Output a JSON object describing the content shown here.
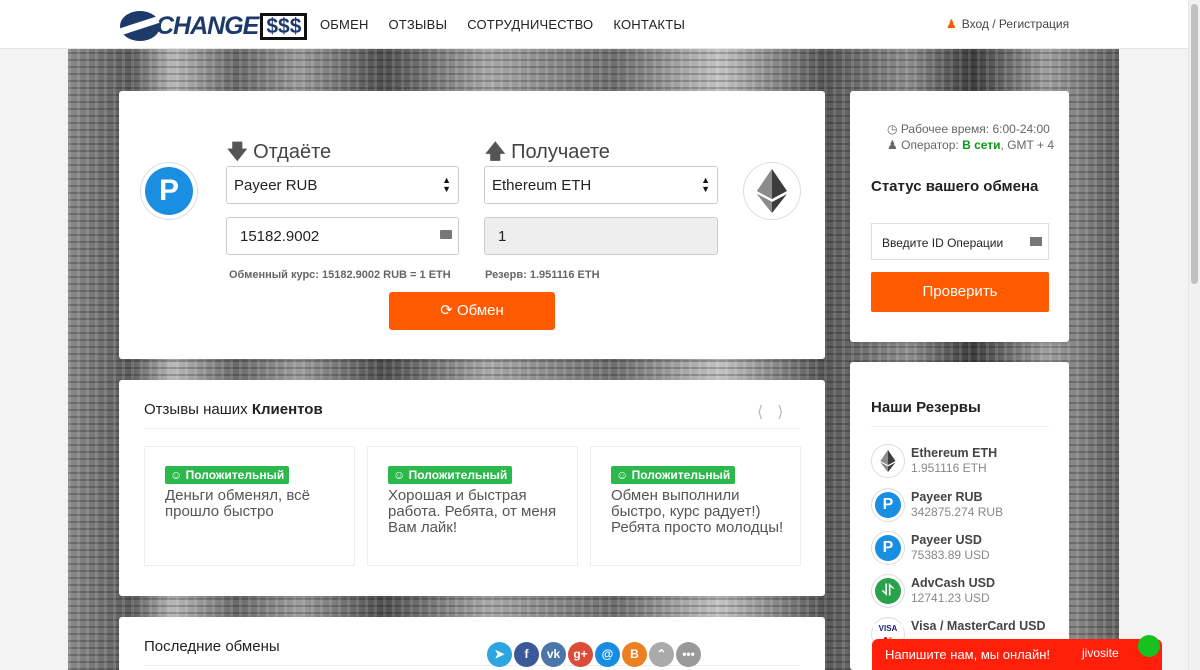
{
  "header": {
    "logo_text": "CHANGE",
    "logo_dollars": "$$$",
    "nav": [
      "ОБМЕН",
      "ОТЗЫВЫ",
      "СОТРУДНИЧЕСТВО",
      "КОНТАКТЫ"
    ],
    "login": "Вход / Регистрация"
  },
  "exchange": {
    "give_label": "Отдаёте",
    "get_label": "Получаете",
    "give_currency": "Payeer RUB",
    "get_currency": "Ethereum ETH",
    "give_amount": "15182.9002",
    "get_amount": "1",
    "rate": "Обменный курс: 15182.9002 RUB = 1 ETH",
    "reserve": "Резерв: 1.951116 ETH",
    "button": "Обмен",
    "give_icon_letter": "P"
  },
  "status": {
    "work_time": "Рабочее время: 6:00-24:00",
    "operator_label": "Оператор:",
    "operator_status": "В сети",
    "timezone": ", GMT + 4",
    "title": "Статус вашего обмена",
    "input_placeholder": "Введите ID Операции",
    "button": "Проверить"
  },
  "reviews": {
    "title_prefix": "Отзывы наших",
    "title_bold": "Клиентов",
    "items": [
      {
        "badge": "Положительный",
        "text": "Деньги обменял, всё прошло быстро"
      },
      {
        "badge": "Положительный",
        "text": "Хорошая и быстрая работа. Ребята, от меня Вам лайк!"
      },
      {
        "badge": "Положительный",
        "text": "Обмен выполнили быстро, курс радует!) Ребята просто молодцы!"
      }
    ]
  },
  "reserves": {
    "title": "Наши Резервы",
    "items": [
      {
        "name": "Ethereum ETH",
        "value": "1.951116 ETH"
      },
      {
        "name": "Payeer RUB",
        "value": "342875.274 RUB"
      },
      {
        "name": "Payeer USD",
        "value": "75383.89 USD"
      },
      {
        "name": "AdvCash USD",
        "value": "12741.23 USD"
      },
      {
        "name": "Visa / MasterCard USD",
        "value": ""
      }
    ]
  },
  "recent": {
    "title": "Последние обмены"
  },
  "chat": {
    "text": "Напишите нам, мы онлайн!",
    "brand": "jivosite"
  },
  "colors": {
    "accent": "#ff5a00",
    "online": "#0a9a1a",
    "positive": "#2db84d",
    "chat": "#ff1f0a"
  }
}
